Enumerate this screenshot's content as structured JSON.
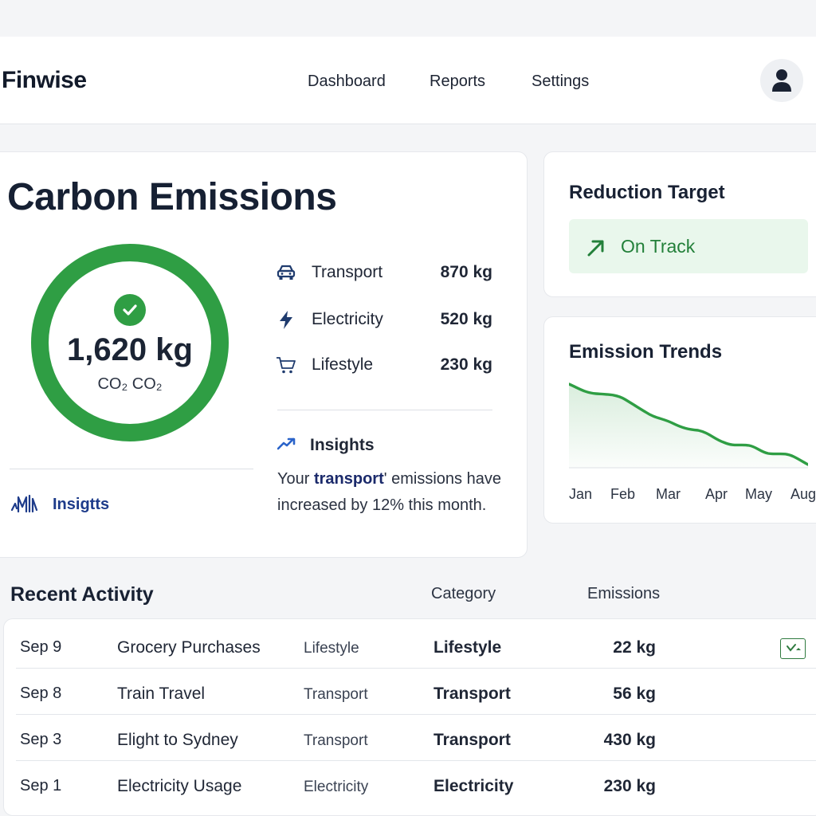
{
  "header": {
    "brand": "Finwise",
    "nav": [
      "Dashboard",
      "Reports",
      "Settings"
    ]
  },
  "emissions": {
    "title": "Carbon Emissions",
    "total": "1,620 kg",
    "unit": "CO₂ CO₂",
    "categories": [
      {
        "label": "Transport",
        "value": "870 kg",
        "icon": "car-icon"
      },
      {
        "label": "Electricity",
        "value": "520 kg",
        "icon": "lightning-icon"
      },
      {
        "label": "Lifestyle",
        "value": "230 kg",
        "icon": "cart-icon"
      }
    ],
    "insights_heading": "Insights",
    "insight_prefix": "Your ",
    "insight_keyword": "transport",
    "insight_suffix": "' emissions have increased by 12% this month.",
    "insights_link": "Insigtts"
  },
  "reduction_target": {
    "title": "Reduction Target",
    "status": "On Track"
  },
  "emission_trends": {
    "title": "Emission Trends",
    "x_labels": [
      "Jan",
      "Feb",
      "Mar",
      "Apr",
      "May",
      "Aug"
    ]
  },
  "recent_activity": {
    "title": "Recent Activity",
    "col_category": "Category",
    "col_emissions": "Emissions",
    "rows": [
      {
        "date": "Sep 9",
        "name": "Grocery Purchases",
        "tag": "Lifestyle",
        "category": "Lifestyle",
        "emissions": "22 kg"
      },
      {
        "date": "Sep 8",
        "name": "Train Travel",
        "tag": "Transport",
        "category": "Transport",
        "emissions": "56 kg"
      },
      {
        "date": "Sep 3",
        "name": "Elight to Sydney",
        "tag": "Transport",
        "category": "Transport",
        "emissions": "430 kg"
      },
      {
        "date": "Sep 1",
        "name": "Electricity Usage",
        "tag": "Electricity",
        "category": "Electricity",
        "emissions": "230 kg"
      }
    ]
  },
  "colors": {
    "accent_green": "#2f9e44",
    "link_blue": "#1d3b8a",
    "ontrack_bg": "#e9f7ec"
  }
}
